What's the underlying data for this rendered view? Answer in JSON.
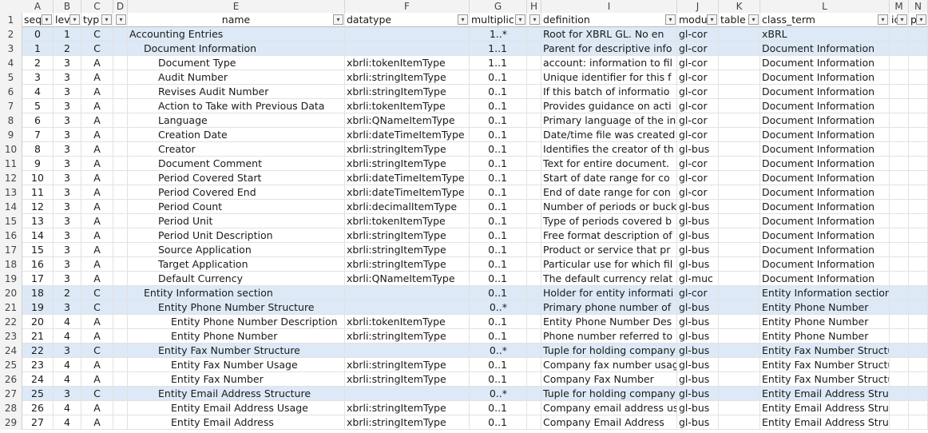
{
  "columns": [
    "A",
    "B",
    "C",
    "D",
    "E",
    "F",
    "G",
    "H",
    "I",
    "J",
    "K",
    "L",
    "M",
    "N"
  ],
  "headers": [
    "sequ",
    "lev",
    "typ",
    "",
    "name",
    "datatype",
    "multiplic",
    "",
    "definition",
    "modu",
    "table",
    "class_term",
    "ic",
    "p"
  ],
  "row_numbers": [
    "1",
    "2",
    "3",
    "4",
    "5",
    "6",
    "7",
    "8",
    "9",
    "10",
    "11",
    "12",
    "13",
    "14",
    "15",
    "16",
    "17",
    "18",
    "19",
    "20",
    "21",
    "22",
    "23",
    "24",
    "25",
    "26",
    "27",
    "28",
    "29"
  ],
  "rows": [
    {
      "seq": "0",
      "lev": "1",
      "type": "C",
      "name": "Accounting Entries",
      "datatype": "",
      "mult": "1..*",
      "def": "Root for XBRL GL. No en",
      "mod": "gl-cor",
      "table": "",
      "class": "xBRL"
    },
    {
      "seq": "1",
      "lev": "2",
      "type": "C",
      "name": "Document Information",
      "datatype": "",
      "mult": "1..1",
      "def": "Parent for descriptive info",
      "mod": "gl-cor",
      "table": "",
      "class": "Document Information"
    },
    {
      "seq": "2",
      "lev": "3",
      "type": "A",
      "name": "Document Type",
      "datatype": "xbrli:tokenItemType",
      "mult": "1..1",
      "def": "account: information to fil",
      "mod": "gl-cor",
      "table": "",
      "class": "Document Information"
    },
    {
      "seq": "3",
      "lev": "3",
      "type": "A",
      "name": "Audit Number",
      "datatype": "xbrli:stringItemType",
      "mult": "0..1",
      "def": "Unique identifier for this f",
      "mod": "gl-cor",
      "table": "",
      "class": "Document Information"
    },
    {
      "seq": "4",
      "lev": "3",
      "type": "A",
      "name": "Revises Audit Number",
      "datatype": "xbrli:stringItemType",
      "mult": "0..1",
      "def": "If this batch of informatio",
      "mod": "gl-cor",
      "table": "",
      "class": "Document Information"
    },
    {
      "seq": "5",
      "lev": "3",
      "type": "A",
      "name": "Action to Take with Previous Data",
      "datatype": "xbrli:tokenItemType",
      "mult": "0..1",
      "def": "Provides guidance on acti",
      "mod": "gl-cor",
      "table": "",
      "class": "Document Information"
    },
    {
      "seq": "6",
      "lev": "3",
      "type": "A",
      "name": "Language",
      "datatype": "xbrli:QNameItemType",
      "mult": "0..1",
      "def": "Primary language of the in",
      "mod": "gl-cor",
      "table": "",
      "class": "Document Information"
    },
    {
      "seq": "7",
      "lev": "3",
      "type": "A",
      "name": "Creation Date",
      "datatype": "xbrli:dateTimeItemType",
      "mult": "0..1",
      "def": "Date/time file was created",
      "mod": "gl-cor",
      "table": "",
      "class": "Document Information"
    },
    {
      "seq": "8",
      "lev": "3",
      "type": "A",
      "name": "Creator",
      "datatype": "xbrli:stringItemType",
      "mult": "0..1",
      "def": "Identifies the creator of th",
      "mod": "gl-bus",
      "table": "",
      "class": "Document Information"
    },
    {
      "seq": "9",
      "lev": "3",
      "type": "A",
      "name": "Document Comment",
      "datatype": "xbrli:stringItemType",
      "mult": "0..1",
      "def": "Text for entire document.",
      "mod": "gl-cor",
      "table": "",
      "class": "Document Information"
    },
    {
      "seq": "10",
      "lev": "3",
      "type": "A",
      "name": "Period Covered Start",
      "datatype": "xbrli:dateTimeItemType",
      "mult": "0..1",
      "def": "Start of date range for co",
      "mod": "gl-cor",
      "table": "",
      "class": "Document Information"
    },
    {
      "seq": "11",
      "lev": "3",
      "type": "A",
      "name": "Period Covered End",
      "datatype": "xbrli:dateTimeItemType",
      "mult": "0..1",
      "def": "End of date range for con",
      "mod": "gl-cor",
      "table": "",
      "class": "Document Information"
    },
    {
      "seq": "12",
      "lev": "3",
      "type": "A",
      "name": "Period Count",
      "datatype": "xbrli:decimalItemType",
      "mult": "0..1",
      "def": "Number of periods or buck",
      "mod": "gl-bus",
      "table": "",
      "class": "Document Information"
    },
    {
      "seq": "13",
      "lev": "3",
      "type": "A",
      "name": "Period Unit",
      "datatype": "xbrli:tokenItemType",
      "mult": "0..1",
      "def": "Type of periods covered b",
      "mod": "gl-bus",
      "table": "",
      "class": "Document Information"
    },
    {
      "seq": "14",
      "lev": "3",
      "type": "A",
      "name": "Period Unit Description",
      "datatype": "xbrli:stringItemType",
      "mult": "0..1",
      "def": "Free format description of",
      "mod": "gl-bus",
      "table": "",
      "class": "Document Information"
    },
    {
      "seq": "15",
      "lev": "3",
      "type": "A",
      "name": "Source Application",
      "datatype": "xbrli:stringItemType",
      "mult": "0..1",
      "def": "Product or service that pr",
      "mod": "gl-bus",
      "table": "",
      "class": "Document Information"
    },
    {
      "seq": "16",
      "lev": "3",
      "type": "A",
      "name": "Target Application",
      "datatype": "xbrli:stringItemType",
      "mult": "0..1",
      "def": "Particular use for which fil",
      "mod": "gl-bus",
      "table": "",
      "class": "Document Information"
    },
    {
      "seq": "17",
      "lev": "3",
      "type": "A",
      "name": "Default Currency",
      "datatype": "xbrli:QNameItemType",
      "mult": "0..1",
      "def": "The default currency relat",
      "mod": "gl-muc",
      "table": "",
      "class": "Document Information"
    },
    {
      "seq": "18",
      "lev": "2",
      "type": "C",
      "name": "Entity Information section",
      "datatype": "",
      "mult": "0..1",
      "def": "Holder for entity informati",
      "mod": "gl-cor",
      "table": "",
      "class": "Entity Information section"
    },
    {
      "seq": "19",
      "lev": "3",
      "type": "C",
      "name": "Entity Phone Number Structure",
      "datatype": "",
      "mult": "0..*",
      "def": "Primary phone number of",
      "mod": "gl-bus",
      "table": "",
      "class": "Entity Phone Number"
    },
    {
      "seq": "20",
      "lev": "4",
      "type": "A",
      "name": "Entity Phone Number Description",
      "datatype": "xbrli:tokenItemType",
      "mult": "0..1",
      "def": "Entity Phone Number Des",
      "mod": "gl-bus",
      "table": "",
      "class": "Entity Phone Number"
    },
    {
      "seq": "21",
      "lev": "4",
      "type": "A",
      "name": "Entity Phone Number",
      "datatype": "xbrli:stringItemType",
      "mult": "0..1",
      "def": "Phone number referred to",
      "mod": "gl-bus",
      "table": "",
      "class": "Entity Phone Number"
    },
    {
      "seq": "22",
      "lev": "3",
      "type": "C",
      "name": "Entity Fax Number Structure",
      "datatype": "",
      "mult": "0..*",
      "def": "Tuple for holding company",
      "mod": "gl-bus",
      "table": "",
      "class": "Entity Fax Number Structure"
    },
    {
      "seq": "23",
      "lev": "4",
      "type": "A",
      "name": "Entity Fax Number Usage",
      "datatype": "xbrli:stringItemType",
      "mult": "0..1",
      "def": "Company fax number usag",
      "mod": "gl-bus",
      "table": "",
      "class": "Entity Fax Number Structure"
    },
    {
      "seq": "24",
      "lev": "4",
      "type": "A",
      "name": "Entity Fax Number",
      "datatype": "xbrli:stringItemType",
      "mult": "0..1",
      "def": "Company Fax Number",
      "mod": "gl-bus",
      "table": "",
      "class": "Entity Fax Number Structure"
    },
    {
      "seq": "25",
      "lev": "3",
      "type": "C",
      "name": "Entity Email Address Structure",
      "datatype": "",
      "mult": "0..*",
      "def": "Tuple for holding company",
      "mod": "gl-bus",
      "table": "",
      "class": "Entity Email Address Structure"
    },
    {
      "seq": "26",
      "lev": "4",
      "type": "A",
      "name": "Entity Email Address Usage",
      "datatype": "xbrli:stringItemType",
      "mult": "0..1",
      "def": "Company email address us",
      "mod": "gl-bus",
      "table": "",
      "class": "Entity Email Address Structure"
    },
    {
      "seq": "27",
      "lev": "4",
      "type": "A",
      "name": "Entity Email Address",
      "datatype": "xbrli:stringItemType",
      "mult": "0..1",
      "def": "Company Email Address",
      "mod": "gl-bus",
      "table": "",
      "class": "Entity Email Address Structure"
    }
  ],
  "colors": {
    "c_row": "#dde9f6",
    "header_bg": "#f3f3f3",
    "grid": "#e2e2e2"
  }
}
